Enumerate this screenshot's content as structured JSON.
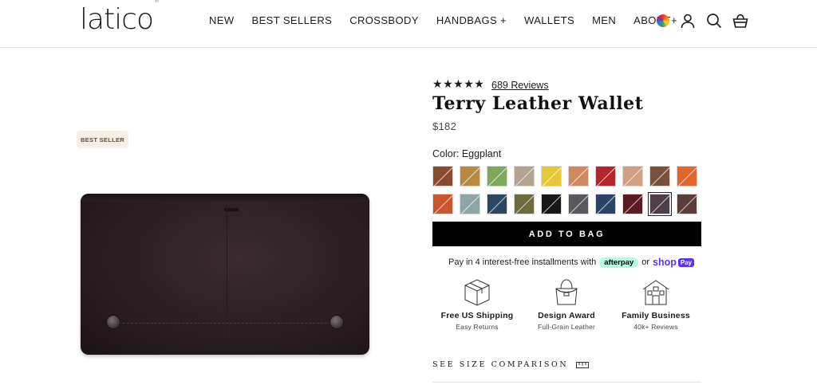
{
  "header": {
    "logo": "latico",
    "logo_mark": "®",
    "nav": [
      "NEW",
      "BEST SELLERS",
      "CROSSBODY",
      "HANDBAGS +",
      "WALLETS",
      "MEN",
      "ABOUT+"
    ],
    "icons": [
      "color-wheel-icon",
      "account-icon",
      "search-icon",
      "cart-icon"
    ]
  },
  "product": {
    "badge": "BEST SELLER",
    "rating_stars": 5,
    "reviews": "689 Reviews",
    "title": "Terry Leather Wallet",
    "price": "$182",
    "color_label": "Color: Eggplant",
    "swatches": [
      [
        "#8a4a2e",
        "#b98a3e",
        "#7fa85a",
        "#b3a38f",
        "#e6c935",
        "#cf8a62",
        "#b4252b",
        "#cfa083",
        "#7a4f3c",
        "#e0662e"
      ],
      [
        "#c9562c",
        "#8fa6a8",
        "#2f4663",
        "#6d6b3e",
        "#171717",
        "#58585e",
        "#2a4468",
        "#5c1a22",
        "#4e3e49",
        "#5a3e37"
      ]
    ],
    "selected_swatch": [
      1,
      8
    ],
    "add_to_bag": "ADD TO BAG",
    "installments": "Pay in 4 interest-free installments with",
    "afterpay": "afterpay",
    "or": "or",
    "shop": "shop",
    "pay": "Pay",
    "features": [
      {
        "icon": "box-icon",
        "title": "Free US Shipping",
        "sub": "Easy Returns"
      },
      {
        "icon": "bag-icon",
        "title": "Design Award",
        "sub": "Full-Grain Leather"
      },
      {
        "icon": "house-icon",
        "title": "Family Business",
        "sub": "40k+ Reviews"
      }
    ],
    "size_compare": "SEE SIZE COMPARISON"
  }
}
